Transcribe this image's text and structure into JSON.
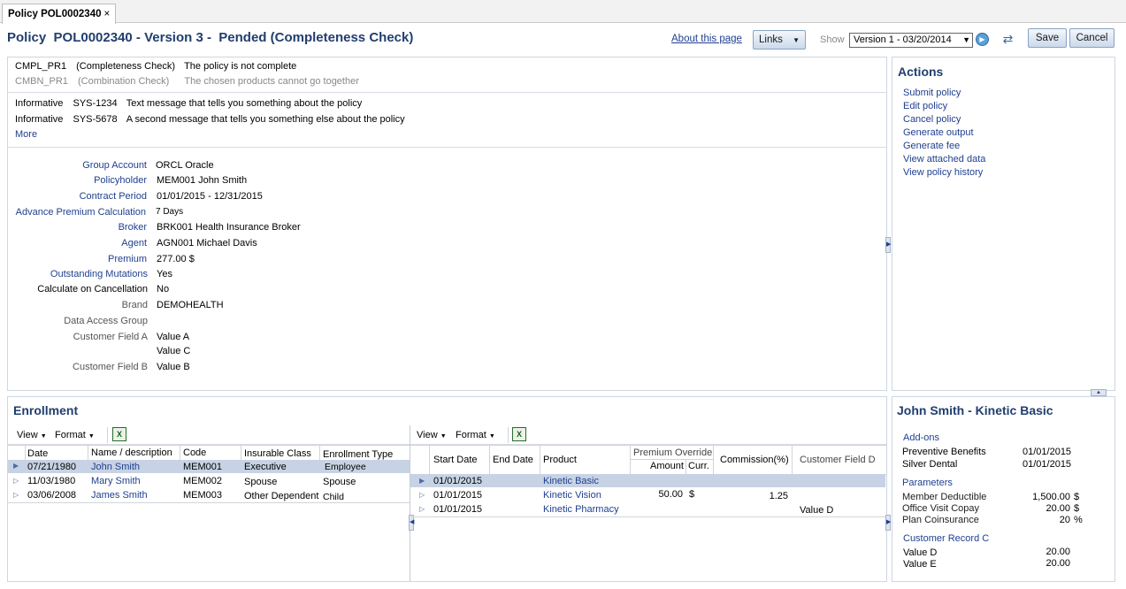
{
  "tab": {
    "label": "Policy POL0002340",
    "close": "×"
  },
  "header": {
    "title": "Policy  POL0002340 - Version 3 -  Pended (Completeness Check)",
    "about_link": "About this page",
    "links_label": "Links",
    "show_label": "Show",
    "version_value": "Version 1 - 03/20/2014",
    "save_label": "Save",
    "cancel_label": "Cancel"
  },
  "messages": {
    "checks": [
      {
        "code": "CMPL_PR1",
        "type": "(Completeness Check)",
        "text": "The policy is not complete"
      },
      {
        "code": "CMBN_PR1",
        "type": "(Combination Check)",
        "text": "The chosen products cannot go together"
      }
    ],
    "info": [
      {
        "level": "Informative",
        "code": "SYS-1234",
        "text": "Text message that tells you something about the policy"
      },
      {
        "level": "Informative",
        "code": "SYS-5678",
        "text": "A second message that tells you something else about the policy"
      }
    ],
    "more_link": "More"
  },
  "fields": {
    "group_account": {
      "label": "Group Account",
      "value": "ORCL Oracle"
    },
    "policyholder": {
      "label": "Policyholder",
      "value": "MEM001 John Smith"
    },
    "contract_period": {
      "label": "Contract Period",
      "value": "01/01/2015 - 12/31/2015"
    },
    "advance_premium": {
      "label": "Advance Premium Calculation",
      "value": "7 Days"
    },
    "broker": {
      "label": "Broker",
      "value": "BRK001 Health Insurance Broker"
    },
    "agent": {
      "label": "Agent",
      "value": "AGN001 Michael Davis"
    },
    "premium": {
      "label": "Premium",
      "value": "277.00  $"
    },
    "outstanding": {
      "label": "Outstanding Mutations",
      "value": "Yes"
    },
    "calc_cancel": {
      "label": "Calculate on Cancellation",
      "value": "No"
    },
    "brand": {
      "label": "Brand",
      "value": "DEMOHEALTH"
    },
    "data_access": {
      "label": "Data Access Group",
      "value": ""
    },
    "custom_a": {
      "label": "Customer Field A",
      "value1": "Value A",
      "value2": "Value C"
    },
    "custom_b": {
      "label": "Customer Field B",
      "value": "Value B"
    }
  },
  "actions": {
    "title": "Actions",
    "items": [
      "Submit policy",
      "Edit policy",
      "Cancel policy",
      "Generate output",
      "Generate fee",
      "View attached data",
      "View policy history"
    ]
  },
  "enrollment": {
    "title": "Enrollment",
    "toolbar": {
      "view": "View",
      "format": "Format"
    },
    "headers": [
      "Date",
      "Name / description",
      "Code",
      "Insurable Class",
      "Enrollment Type"
    ],
    "rows": [
      [
        "07/21/1980",
        "John Smith",
        "MEM001",
        "Executive",
        "Employee"
      ],
      [
        "11/03/1980",
        "Mary Smith",
        "MEM002",
        "Spouse",
        "Spouse"
      ],
      [
        "03/06/2008",
        "James Smith",
        "MEM003",
        "Other Dependent",
        "Child"
      ]
    ]
  },
  "products": {
    "toolbar": {
      "view": "View",
      "format": "Format"
    },
    "headers": {
      "start": "Start Date",
      "end": "End Date",
      "product": "Product",
      "premium_override": "Premium Override",
      "amount": "Amount",
      "curr": "Curr.",
      "commission": "Commission(%)",
      "custom_d": "Customer Field D"
    },
    "rows": [
      {
        "start": "01/01/2015",
        "end": "",
        "product": "Kinetic Basic",
        "amount": "",
        "curr": "",
        "commission": "",
        "custom_d": ""
      },
      {
        "start": "01/01/2015",
        "end": "",
        "product": "Kinetic Vision",
        "amount": "50.00",
        "curr": "$",
        "commission": "1.25",
        "custom_d": ""
      },
      {
        "start": "01/01/2015",
        "end": "",
        "product": "Kinetic Pharmacy",
        "amount": "",
        "curr": "",
        "commission": "",
        "custom_d": "Value D"
      }
    ]
  },
  "detail": {
    "title": "John Smith - Kinetic Basic",
    "addons_title": "Add-ons",
    "addons": [
      [
        "Preventive Benefits",
        "01/01/2015"
      ],
      [
        "Silver Dental",
        "01/01/2015"
      ]
    ],
    "params_title": "Parameters",
    "params": [
      [
        "Member Deductible",
        "1,500.00",
        "$"
      ],
      [
        "Office Visit Copay",
        "20.00",
        "$"
      ],
      [
        "Plan Coinsurance",
        "20",
        "%"
      ]
    ],
    "record_title": "Customer Record C",
    "record": [
      [
        "Value D",
        "20.00"
      ],
      [
        "Value E",
        "20.00"
      ]
    ]
  },
  "colors": {
    "title_blue": "#213e6e",
    "link_blue": "#1f3f8f",
    "selection": "#c7d3e4",
    "panel_border": "#cdd6e1"
  }
}
